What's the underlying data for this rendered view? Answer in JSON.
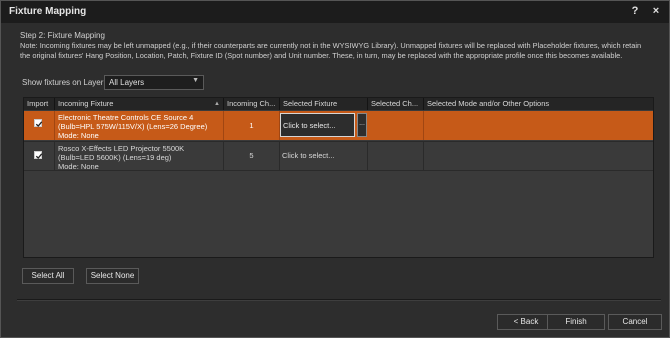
{
  "window": {
    "title": "Fixture Mapping"
  },
  "titlebar": {
    "help_label": "?",
    "close_label": "×"
  },
  "step": "Step 2: Fixture Mapping",
  "note": "Note: Incoming fixtures may be left unmapped (e.g., if their counterparts are currently not in the WYSIWYG Library). Unmapped fixtures will be replaced with Placeholder fixtures, which retain the original fixtures' Hang Position, Location, Patch, Fixture ID (Spot number) and Unit number. These, in turn, may be replaced with the appropriate profile once this becomes available.",
  "layer_filter": {
    "label": "Show fixtures on Layer:",
    "value": "All Layers"
  },
  "table": {
    "columns": [
      "Import",
      "Incoming Fixture",
      "Incoming Ch...",
      "Selected Fixture",
      "Selected Ch...",
      "Selected Mode and/or Other Options"
    ],
    "rows": [
      {
        "import": true,
        "incoming_fixture": "Electronic Theatre Controls CE Source 4 (Bulb=HPL 575W/115V/X) (Lens=26 Degree)",
        "mode": "Mode: None",
        "incoming_ch": "1",
        "selected_fixture": "Click to select...",
        "selected": true,
        "dots": "..."
      },
      {
        "import": true,
        "incoming_fixture": "Rosco X-Effects LED Projector 5500K (Bulb=LED 5600K) (Lens=19 deg)",
        "mode": "Mode: None",
        "incoming_ch": "5",
        "selected_fixture": "Click to select...",
        "selected": false
      }
    ]
  },
  "buttons": {
    "select_all": "Select All",
    "select_none": "Select None",
    "back": "< Back",
    "finish": "Finish",
    "cancel": "Cancel"
  },
  "colors": {
    "selected_row": "#c65a18",
    "background": "#2d2d2d"
  }
}
